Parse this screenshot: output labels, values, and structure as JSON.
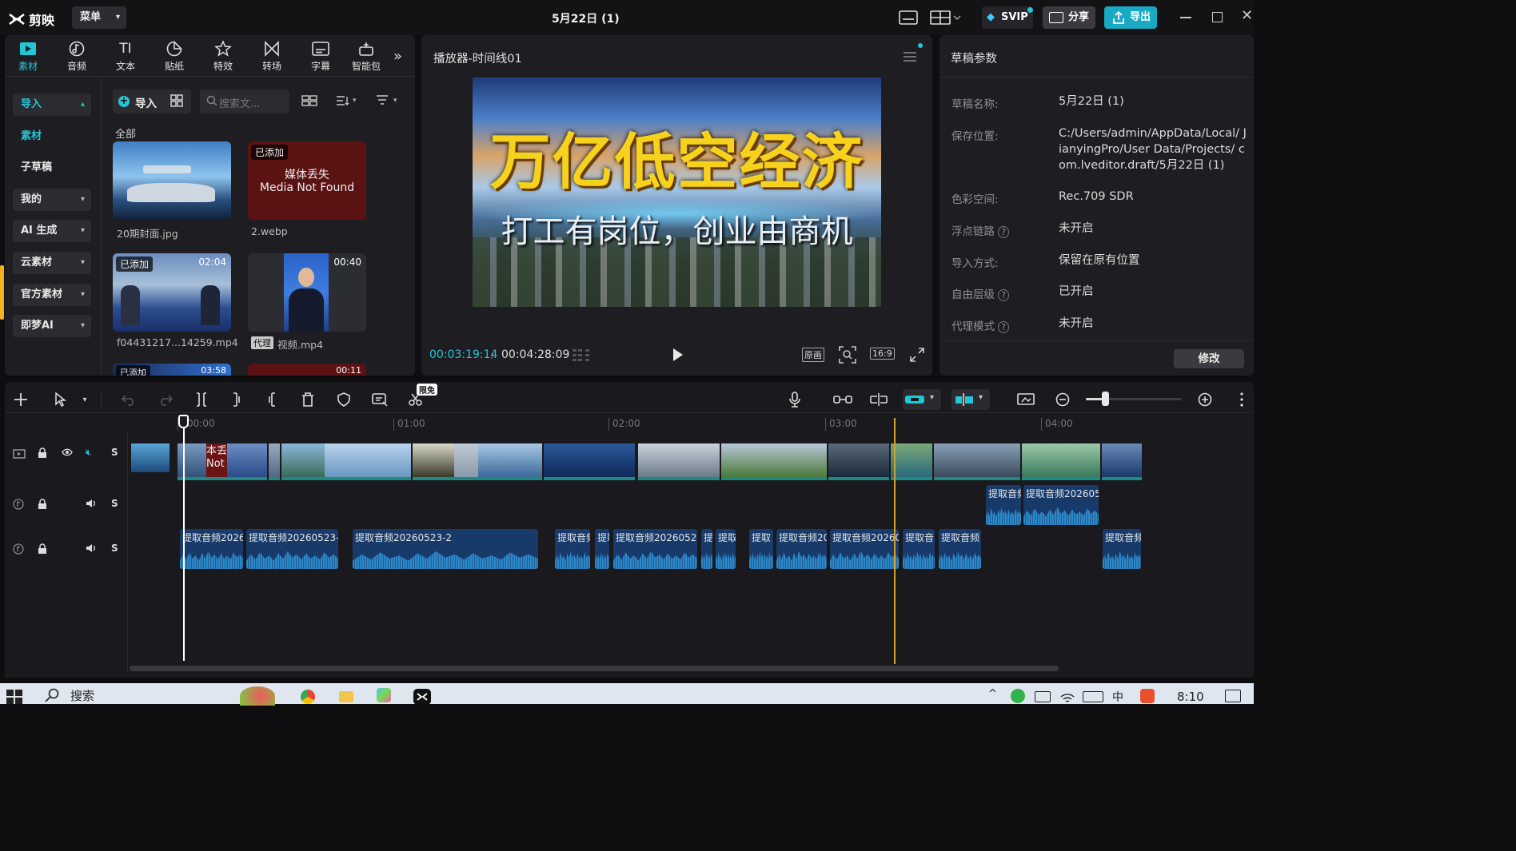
{
  "app": {
    "name": "剪映",
    "menu": "菜单",
    "title": "5月22日 (1)",
    "svip": "SVIP",
    "share": "分享",
    "export": "导出"
  },
  "toolbar_tabs": [
    {
      "label": "素材",
      "icon": "media-icon"
    },
    {
      "label": "音频",
      "icon": "audio-icon"
    },
    {
      "label": "文本",
      "icon": "text-icon"
    },
    {
      "label": "贴纸",
      "icon": "sticker-icon"
    },
    {
      "label": "特效",
      "icon": "effects-icon"
    },
    {
      "label": "转场",
      "icon": "transition-icon"
    },
    {
      "label": "字幕",
      "icon": "subtitle-icon"
    },
    {
      "label": "智能包",
      "icon": "smart-pack-icon"
    }
  ],
  "sidebar": {
    "items": [
      "导入",
      "素材",
      "子草稿",
      "我的",
      "AI 生成",
      "云素材",
      "官方素材",
      "即梦AI"
    ]
  },
  "media": {
    "import_label": "导入",
    "search_placeholder": "搜索文...",
    "section": "全部",
    "items": [
      {
        "name": "20期封面.jpg",
        "badge": "",
        "duration": ""
      },
      {
        "name": "2.webp",
        "badge": "已添加",
        "duration": "",
        "missing_cn": "媒体丢失",
        "missing_en": "Media Not Found"
      },
      {
        "name": "f04431217...14259.mp4",
        "badge": "已添加",
        "duration": "02:04"
      },
      {
        "name": "视频.mp4",
        "badge": "",
        "duration": "00:40",
        "proxy": "代理"
      },
      {
        "name": "",
        "badge": "已添加",
        "duration": "03:58"
      },
      {
        "name": "",
        "badge": "",
        "duration": "00:11"
      }
    ]
  },
  "player": {
    "title": "播放器-时间线01",
    "headline": "万亿低空经济",
    "subline": "打工有岗位，创业由商机",
    "current": "00:03:19:14",
    "total": "00:04:28:09",
    "btn_original": "原画",
    "btn_ratio": "16:9"
  },
  "params": {
    "title": "草稿参数",
    "rows": [
      {
        "label": "草稿名称:",
        "value": "5月22日 (1)"
      },
      {
        "label": "保存位置:",
        "value": "C:/Users/admin/AppData/Local/ JianyingPro/User Data/Projects/ com.lveditor.draft/5月22日 (1)"
      },
      {
        "label": "色彩空间:",
        "value": "Rec.709 SDR"
      },
      {
        "label": "浮点链路",
        "value": "未开启"
      },
      {
        "label": "导入方式:",
        "value": "保留在原有位置"
      },
      {
        "label": "自由层级",
        "value": "已开启"
      },
      {
        "label": "代理模式",
        "value": "未开启"
      }
    ],
    "edit": "修改"
  },
  "timeline": {
    "limited_free": "限免",
    "ruler": [
      "00:00",
      "01:00",
      "02:00",
      "03:00",
      "04:00"
    ],
    "missing_clip": "本丢 Not",
    "audio_row1": [
      "提取音频",
      "提取音频202605"
    ],
    "audio_row2": [
      "提取音频2026",
      "提取音频20260523-",
      "提取音频20260523-2",
      "提取音频",
      "提取",
      "提取音频2026052",
      "提",
      "提取",
      "提取",
      "提取音频2026",
      "提取音频20260",
      "提取音",
      "提取音频",
      "提取音频"
    ]
  },
  "taskbar": {
    "search": "搜索",
    "time": "8:10"
  },
  "colors": {
    "accent": "#22c7d6",
    "export_bg": "#1aa9c4",
    "clip_track": "#1d8a86",
    "audio": "#173a6a",
    "playhead": "#ffffff",
    "marker": "#d2a12a",
    "headline_yellow": "#f6d21c"
  }
}
